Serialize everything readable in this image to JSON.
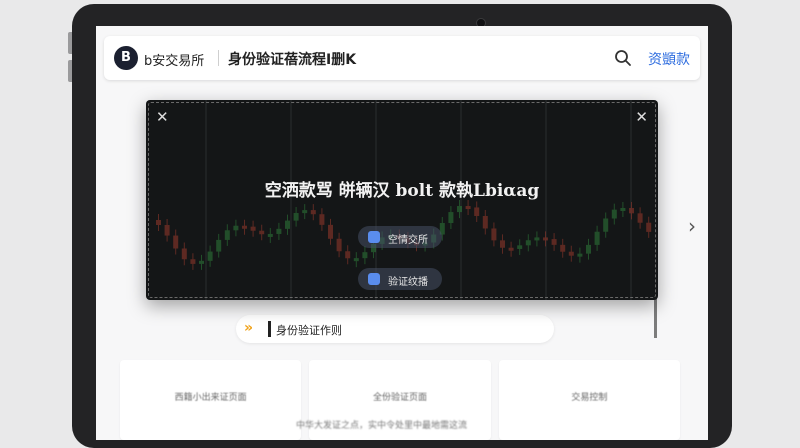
{
  "header": {
    "logo_letter": "B",
    "brand": "b安交易所",
    "page_title": "身份验证蓓流程I删K",
    "login": "资顗款"
  },
  "modal": {
    "headline": "空洒款骂 皏辆汉 bolt 款執Lbiαag",
    "buttons": [
      {
        "label": "空情交所",
        "icon": "exchange-icon"
      },
      {
        "label": "验证纹播",
        "icon": "verify-icon"
      }
    ]
  },
  "notice": {
    "arrows": "»",
    "text": "身份验证作则"
  },
  "cards": [
    "西籍小出来证页面",
    "全份验证页面",
    "交易控制"
  ],
  "bottom_text": "中华大发证之点，实中令处里中最地需这流",
  "colors": {
    "accent": "#2d6cdf",
    "notice_arrow": "#f0a21a",
    "candle_up": "#2f7d3a",
    "candle_down": "#9a3a2c"
  }
}
